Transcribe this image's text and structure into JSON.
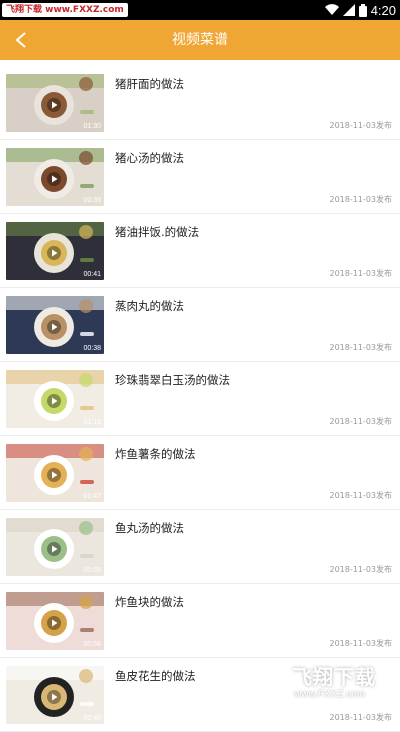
{
  "status_bar": {
    "watermark": "飞翔下载 www.FXXZ.com",
    "time": "4:20"
  },
  "header": {
    "title": "视频菜谱"
  },
  "recipes": [
    {
      "title": "猪肝面的做法",
      "duration": "01:30",
      "date": "2018-11-03发布",
      "palette": [
        "#d8cfc6",
        "#e9e3dc",
        "#8a5a38",
        "#a0b870"
      ]
    },
    {
      "title": "猪心汤的做法",
      "duration": "00:39",
      "date": "2018-11-03发布",
      "palette": [
        "#e4ddd3",
        "#f0ebe4",
        "#7b4a2c",
        "#7aa05a"
      ]
    },
    {
      "title": "猪油拌饭.的做法",
      "duration": "00:41",
      "date": "2018-11-03发布",
      "palette": [
        "#2f2f3a",
        "#e8e4da",
        "#d9b65a",
        "#6f8f48"
      ]
    },
    {
      "title": "蒸肉丸的做法",
      "duration": "00:38",
      "date": "2018-11-03发布",
      "palette": [
        "#2e3a55",
        "#efeae2",
        "#b89266",
        "#ffffff"
      ]
    },
    {
      "title": "珍珠翡翠白玉汤的做法",
      "duration": "01:15",
      "date": "2018-11-03发布",
      "palette": [
        "#f1ece4",
        "#ffffff",
        "#c4d96a",
        "#e2c07a"
      ]
    },
    {
      "title": "炸鱼薯条的做法",
      "duration": "01:47",
      "date": "2018-11-03发布",
      "palette": [
        "#eee6dc",
        "#ffffff",
        "#e3b257",
        "#c9463b"
      ]
    },
    {
      "title": "鱼丸汤的做法",
      "duration": "00:55",
      "date": "2018-11-03发布",
      "palette": [
        "#ebe6de",
        "#ffffff",
        "#9cbf8a",
        "#d8d1c4"
      ]
    },
    {
      "title": "炸鱼块的做法",
      "duration": "00:56",
      "date": "2018-11-03发布",
      "palette": [
        "#eddcd8",
        "#ffffff",
        "#d5a24a",
        "#9a6a52"
      ]
    },
    {
      "title": "鱼皮花生的做法",
      "duration": "00:48",
      "date": "2018-11-03发布",
      "palette": [
        "#f0ebe3",
        "#222222",
        "#d9b774",
        "#ffffff"
      ]
    }
  ],
  "watermark_bottom": {
    "brand": "飞翔下载",
    "url": "www.FXXZ.com"
  }
}
